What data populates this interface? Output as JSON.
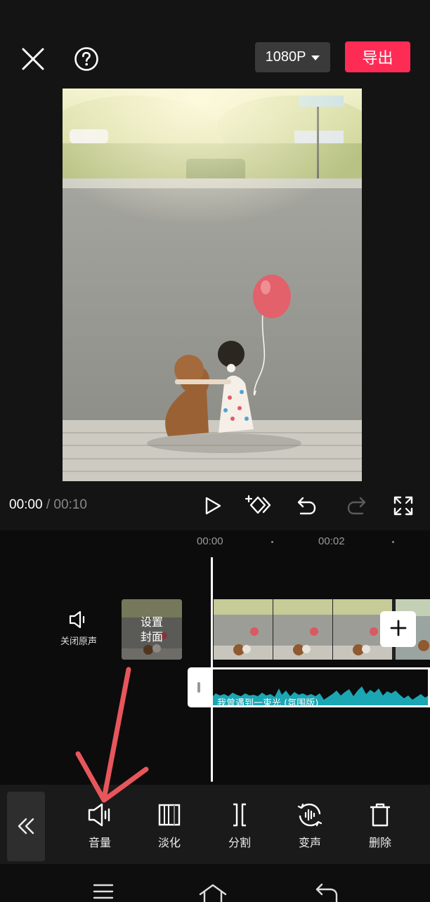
{
  "header": {
    "resolution": "1080P",
    "export_label": "导出"
  },
  "playback": {
    "current_time": "00:00",
    "separator": "/",
    "total_time": "00:10"
  },
  "timeline": {
    "ruler": [
      "00:00",
      "00:02"
    ],
    "mute_label": "关闭原声",
    "cover_label_line1": "设置",
    "cover_label_line2": "封面",
    "audio_track_name": "我曾遇到一束光 (氛围版)"
  },
  "toolbar": {
    "tools": [
      {
        "label": "音量",
        "icon": "volume-icon"
      },
      {
        "label": "淡化",
        "icon": "fade-icon"
      },
      {
        "label": "分割",
        "icon": "split-icon"
      },
      {
        "label": "变声",
        "icon": "voice-change-icon"
      },
      {
        "label": "删除",
        "icon": "delete-icon"
      }
    ]
  },
  "colors": {
    "accent": "#fe2c55",
    "waveform": "#1ba6b3",
    "annotation_arrow": "#e8565b"
  }
}
